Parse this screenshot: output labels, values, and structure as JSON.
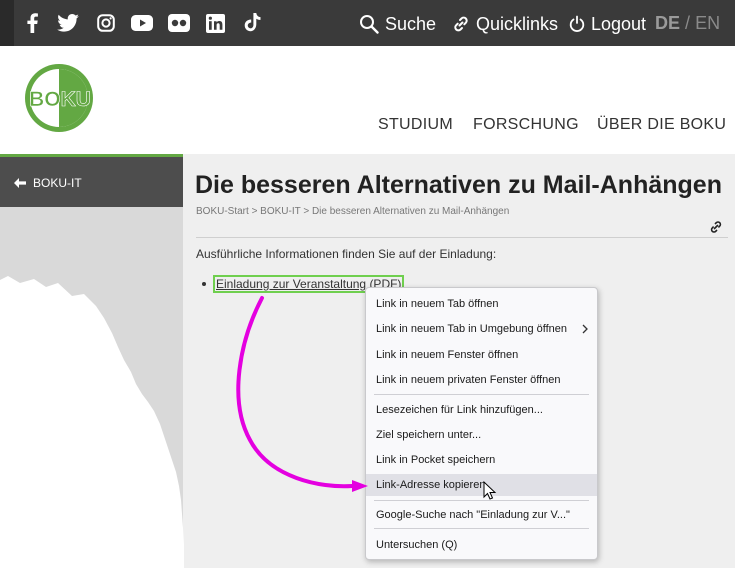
{
  "topbar": {
    "social_icons": [
      "facebook-icon",
      "twitter-icon",
      "instagram-icon",
      "youtube-icon",
      "flickr-icon",
      "linkedin-icon",
      "tiktok-icon"
    ],
    "search_label": "Suche",
    "quicklinks_label": "Quicklinks",
    "logout_label": "Logout",
    "lang_de": "DE",
    "lang_sep": "/",
    "lang_en": "EN"
  },
  "header": {
    "logo_text": "BOKU",
    "nav": [
      "STUDIUM",
      "FORSCHUNG",
      "ÜBER DIE BOKU"
    ]
  },
  "sidebar": {
    "back_label": "BOKU-IT"
  },
  "main": {
    "title": "Die besseren Alternativen zu Mail-Anhängen",
    "breadcrumb": "BOKU-Start > BOKU-IT > Die besseren Alternativen zu Mail-Anhängen",
    "intro": "Ausführliche Informationen finden Sie auf der Einladung:",
    "link_label": "Einladung zur Veranstaltung (PDF)"
  },
  "context_menu": {
    "items": [
      "Link in neuem Tab öffnen",
      "Link in neuem Tab in Umgebung öffnen",
      "Link in neuem Fenster öffnen",
      "Link in neuem privaten Fenster öffnen",
      "Lesezeichen für Link hinzufügen...",
      "Ziel speichern unter...",
      "Link in Pocket speichern",
      "Link-Adresse kopieren",
      "Google-Suche nach \"Einladung zur V...\"",
      "Untersuchen (Q)"
    ],
    "highlighted_index": 7
  },
  "colors": {
    "topbar": "#3a3a3a",
    "boku_green": "#63a843",
    "annotation_arrow": "#e400e0",
    "sidebar": "#4d4d4d"
  }
}
